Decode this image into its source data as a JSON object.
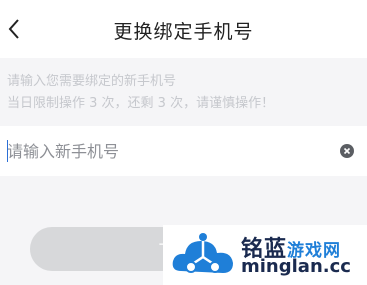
{
  "nav": {
    "title": "更换绑定手机号",
    "back_icon": "chevron-left-icon"
  },
  "notice": {
    "line1": "请输入您需要绑定的新手机号",
    "line2": "当日限制操作 3 次，还剩 3 次，请谨慎操作！"
  },
  "phone_input": {
    "value": "",
    "placeholder": "请输入新手机号",
    "clear_icon": "clear-circle-icon"
  },
  "submit_button": {
    "label": "下一步"
  },
  "watermark": {
    "brand": "铭蓝",
    "brand_suffix": "游戏网",
    "url": "minglan.cc"
  },
  "colors": {
    "background": "#f5f5f7",
    "button_disabled": "#d7d8da",
    "hint_text": "#c6c8cd",
    "watermark_blue": "#1f7fd8"
  }
}
